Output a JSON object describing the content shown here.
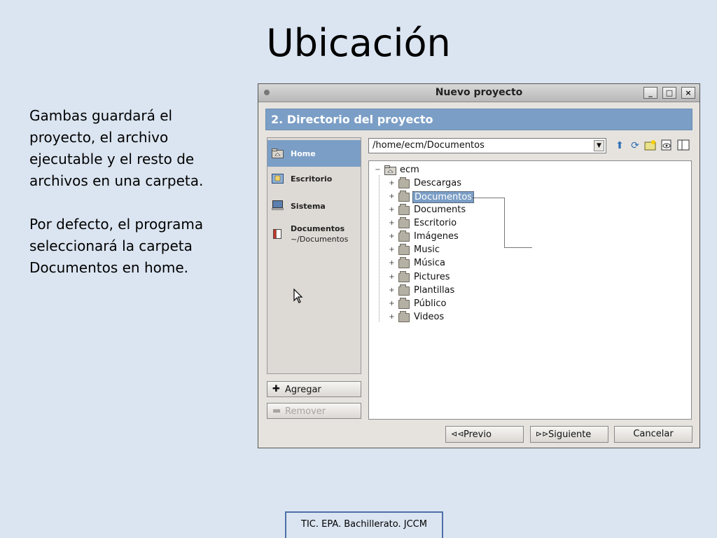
{
  "slide": {
    "title": "Ubicación",
    "paragraph1": "Gambas guardará el proyecto, el archivo ejecutable y el resto de archivos en una carpeta.",
    "paragraph2": "Por defecto, el programa seleccionará la carpeta Documentos en home.",
    "footer": "TIC. EPA. Bachillerato. JCCM"
  },
  "window": {
    "title": "Nuevo proyecto",
    "controls": {
      "minimize": "_",
      "maximize": "□",
      "close": "×"
    },
    "step_header": "2. Directorio del proyecto"
  },
  "places": {
    "items": [
      {
        "label": "Home",
        "icon": "home-folder-icon",
        "selected": true
      },
      {
        "label": "Escritorio",
        "icon": "desktop-icon",
        "selected": false
      },
      {
        "label": "Sistema",
        "icon": "computer-icon",
        "selected": false
      },
      {
        "label": "Documentos",
        "sub": "~/Documentos",
        "icon": "bookmark-icon",
        "selected": false
      }
    ],
    "add_label": "Agregar",
    "remove_label": "Remover"
  },
  "path": {
    "value": "/home/ecm/Documentos"
  },
  "toolbar": {
    "icons": [
      "up-arrow-icon",
      "refresh-icon",
      "new-folder-icon",
      "view-hidden-icon",
      "split-view-icon"
    ]
  },
  "tree": {
    "root": "ecm",
    "items": [
      {
        "label": "Descargas",
        "selected": false
      },
      {
        "label": "Documentos",
        "selected": true
      },
      {
        "label": "Documents",
        "selected": false
      },
      {
        "label": "Escritorio",
        "selected": false
      },
      {
        "label": "Imágenes",
        "selected": false
      },
      {
        "label": "Music",
        "selected": false
      },
      {
        "label": "Música",
        "selected": false
      },
      {
        "label": "Pictures",
        "selected": false
      },
      {
        "label": "Plantillas",
        "selected": false
      },
      {
        "label": "Público",
        "selected": false
      },
      {
        "label": "Videos",
        "selected": false
      }
    ]
  },
  "buttons": {
    "previous": "Previo",
    "next": "Siguiente",
    "cancel": "Cancelar"
  },
  "colors": {
    "slide_background": "#dbe5f1",
    "selection": "#7b9ec6",
    "window_background": "#e6e3df"
  }
}
